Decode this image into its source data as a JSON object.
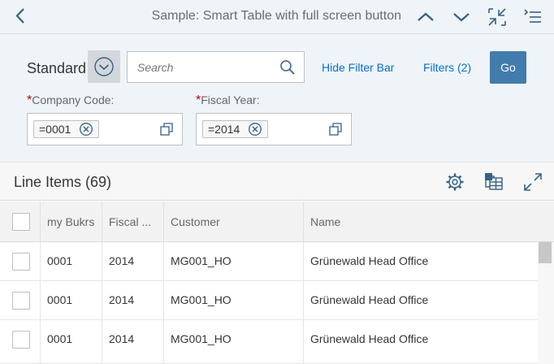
{
  "header": {
    "title": "Sample: Smart Table with full screen button",
    "back_icon": "chevron-left-icon",
    "icons": [
      "chevron-up-icon",
      "chevron-down-icon",
      "exit-full-screen-icon",
      "overflow-menu-icon"
    ]
  },
  "filterbar": {
    "variant_label": "Standard",
    "search_placeholder": "Search",
    "search_value": "",
    "hide_filter_bar_label": "Hide Filter Bar",
    "filters_label": "Filters (2)",
    "go_label": "Go",
    "fields": [
      {
        "required_mark": "*",
        "label": "Company Code:",
        "token": "=0001"
      },
      {
        "required_mark": "*",
        "label": "Fiscal Year:",
        "token": "=2014"
      }
    ]
  },
  "table": {
    "title": "Line Items (69)",
    "columns": [
      "my Bukrs",
      "Fiscal ...",
      "Customer",
      "Name"
    ],
    "rows": [
      {
        "bukrs": "0001",
        "fiscal": "2014",
        "customer": "MG001_HO",
        "name": "Grünewald Head Office"
      },
      {
        "bukrs": "0001",
        "fiscal": "2014",
        "customer": "MG001_HO",
        "name": "Grünewald Head Office"
      },
      {
        "bukrs": "0001",
        "fiscal": "2014",
        "customer": "MG001_HO",
        "name": "Grünewald Head Office"
      }
    ]
  },
  "colors": {
    "accent": "#427cac",
    "link": "#0a6ed1",
    "required": "#bb0000",
    "shell_background": "#eff4f9",
    "icon": "#346187"
  }
}
